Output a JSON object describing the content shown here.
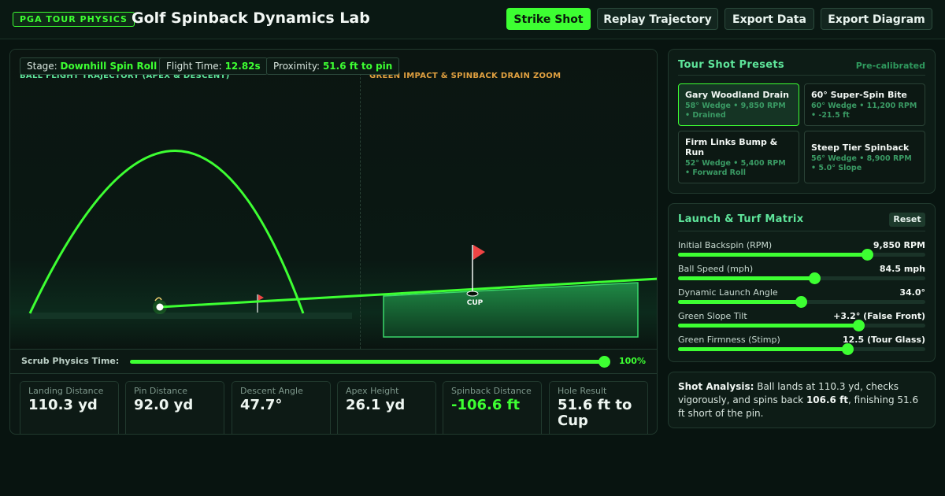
{
  "header": {
    "badge": "PGA TOUR PHYSICS",
    "title": "Golf Spinback Dynamics Lab",
    "buttons": {
      "strike": "Strike Shot",
      "replay": "Replay Trajectory",
      "export_data": "Export Data",
      "export_diagram": "Export Diagram"
    }
  },
  "sim": {
    "chips": {
      "stage_label": "Stage:",
      "stage_value": "Downhill Spin Roll",
      "flight_label": "Flight Time:",
      "flight_value": "12.82s",
      "prox_label": "Proximity:",
      "prox_value": "51.6 ft to pin"
    },
    "zones": {
      "left": "BALL FLIGHT TRAJECTORY (APEX & DESCENT)",
      "right": "GREEN IMPACT & SPINBACK DRAIN ZOOM"
    },
    "cup_label": "CUP",
    "scrub": {
      "label": "Scrub Physics Time:",
      "value": "100%",
      "fraction": 1.0
    }
  },
  "stats": [
    {
      "label": "Landing Distance",
      "value": "110.3 yd"
    },
    {
      "label": "Pin Distance",
      "value": "92.0 yd"
    },
    {
      "label": "Descent Angle",
      "value": "47.7°"
    },
    {
      "label": "Apex Height",
      "value": "26.1 yd"
    },
    {
      "label": "Spinback Distance",
      "value": "-106.6 ft"
    },
    {
      "label": "Hole Result",
      "value": "51.6 ft to Cup"
    }
  ],
  "presets": {
    "title": "Tour Shot Presets",
    "status": "Pre-calibrated",
    "items": [
      {
        "name": "Gary Woodland Drain",
        "meta": "58° Wedge • 9,850 RPM • Drained"
      },
      {
        "name": "60° Super-Spin Bite",
        "meta": "60° Wedge • 11,200 RPM • -21.5 ft"
      },
      {
        "name": "Firm Links Bump & Run",
        "meta": "52° Wedge • 5,400 RPM • Forward Roll"
      },
      {
        "name": "Steep Tier Spinback",
        "meta": "56° Wedge • 8,900 RPM • 5.0° Slope"
      }
    ]
  },
  "matrix": {
    "title": "Launch & Turf Matrix",
    "reset": "Reset",
    "sliders": [
      {
        "label": "Initial Backspin (RPM)",
        "value": "9,850 RPM",
        "fraction": 0.765
      },
      {
        "label": "Ball Speed (mph)",
        "value": "84.5 mph",
        "fraction": 0.551
      },
      {
        "label": "Dynamic Launch Angle",
        "value": "34.0°",
        "fraction": 0.497
      },
      {
        "label": "Green Slope Tilt",
        "value": "+3.2° (False Front)",
        "fraction": 0.73
      },
      {
        "label": "Green Firmness (Stimp)",
        "value": "12.5 (Tour Glass)",
        "fraction": 0.686
      }
    ]
  },
  "analysis": {
    "lead": "Shot Analysis:",
    "part1": " Ball lands at 110.3 yd, checks vigorously, and spins back ",
    "highlight": "106.6 ft",
    "part2": ", finishing 51.6 ft short of the pin."
  },
  "colors": {
    "accent": "#3dff32",
    "flag": "#ef4444",
    "zone_left": "#5ee49a",
    "zone_right": "#e0a040"
  }
}
